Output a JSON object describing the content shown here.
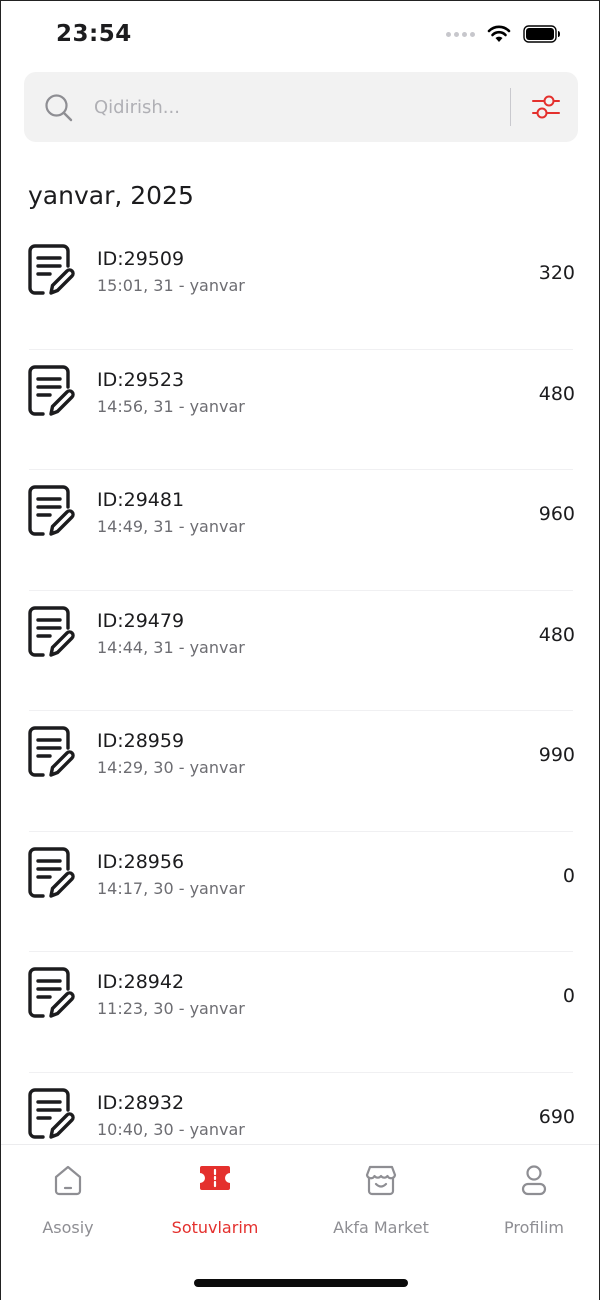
{
  "status_bar": {
    "time": "23:54"
  },
  "search": {
    "placeholder": "Qidirish..."
  },
  "section": {
    "title": "yanvar, 2025"
  },
  "sales": [
    {
      "id": "ID:29509",
      "datetime": "15:01, 31 - yanvar",
      "amount": "320"
    },
    {
      "id": "ID:29523",
      "datetime": "14:56, 31 - yanvar",
      "amount": "480"
    },
    {
      "id": "ID:29481",
      "datetime": "14:49, 31 - yanvar",
      "amount": "960"
    },
    {
      "id": "ID:29479",
      "datetime": "14:44, 31 - yanvar",
      "amount": "480"
    },
    {
      "id": "ID:28959",
      "datetime": "14:29, 30 - yanvar",
      "amount": "990"
    },
    {
      "id": "ID:28956",
      "datetime": "14:17, 30 - yanvar",
      "amount": "0"
    },
    {
      "id": "ID:28942",
      "datetime": "11:23, 30 - yanvar",
      "amount": "0"
    },
    {
      "id": "ID:28932",
      "datetime": "10:40, 30 - yanvar",
      "amount": "690"
    }
  ],
  "tabs": [
    {
      "label": "Asosiy",
      "icon": "home-icon",
      "active": false
    },
    {
      "label": "Sotuvlarim",
      "icon": "ticket-icon",
      "active": true
    },
    {
      "label": "Akfa Market",
      "icon": "store-icon",
      "active": false
    },
    {
      "label": "Profilim",
      "icon": "user-icon",
      "active": false
    }
  ],
  "colors": {
    "accent": "#e4302d",
    "inactive": "#8e8e93",
    "search_bg": "#f2f2f2"
  }
}
